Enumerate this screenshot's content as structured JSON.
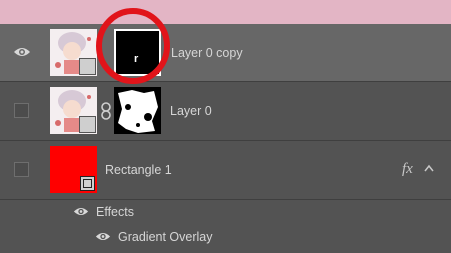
{
  "layers": [
    {
      "name": "Layer 0 copy",
      "visible": true,
      "selected": true,
      "mask": "black",
      "mask_glyph": "r",
      "highlight_color": "#e1141a"
    },
    {
      "name": "Layer 0",
      "visible": false,
      "selected": false,
      "mask": "white-shape"
    },
    {
      "name": "Rectangle 1",
      "visible": false,
      "selected": false,
      "fx_label": "fx",
      "fill_color": "#ff0000"
    }
  ],
  "effects": {
    "label": "Effects",
    "items": [
      "Gradient Overlay"
    ]
  },
  "icons": {
    "visibility": "eye-icon",
    "link": "chain-link-icon",
    "smart_object": "smart-object-badge-icon",
    "shape": "vector-shape-badge-icon",
    "collapse": "chevron-up-icon"
  }
}
